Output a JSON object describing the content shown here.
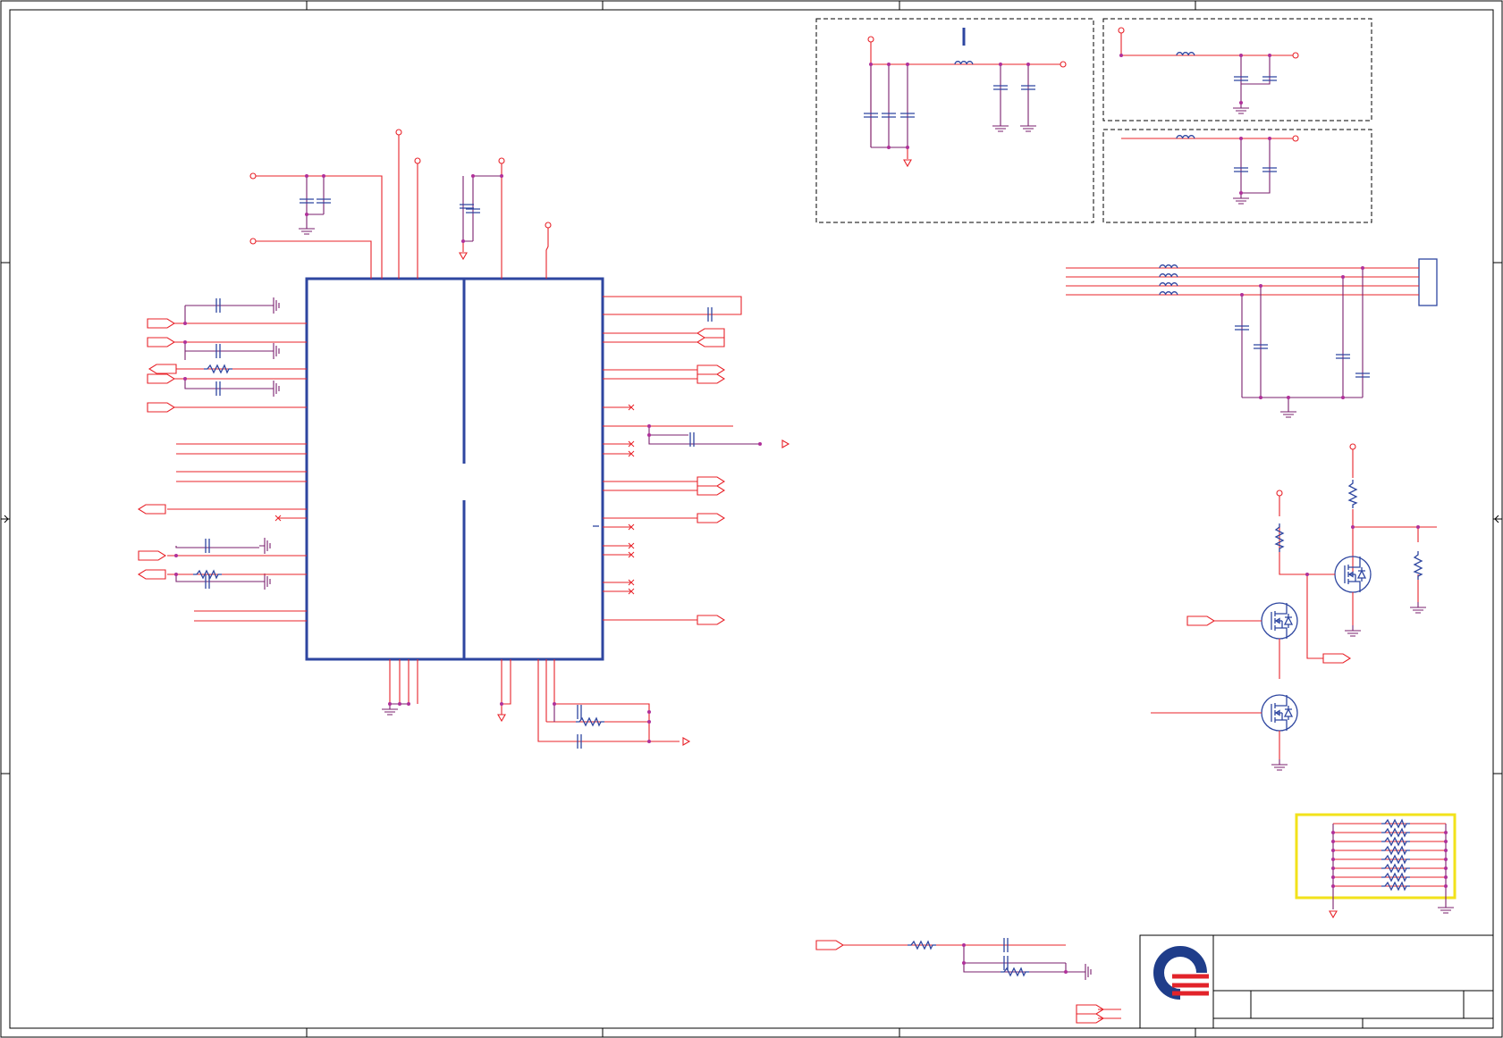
{
  "sheet": {
    "grid_columns": 5,
    "grid_rows": 4,
    "title_block": {
      "logo": "company-logo"
    }
  },
  "colors": {
    "wire": "#e8232a",
    "net": "#7a1f6e",
    "component": "#2e46a0",
    "junction": "#b0309a",
    "highlight": "#f2e21a",
    "logo_blue": "#1f3d8a",
    "logo_red": "#e2232a"
  },
  "icons": {
    "ground": "ground-icon",
    "capacitor": "capacitor-icon",
    "resistor": "resistor-icon",
    "inductor": "inductor-icon",
    "mosfet": "mosfet-icon",
    "port": "port-icon",
    "no_connect": "no-connect-icon"
  }
}
